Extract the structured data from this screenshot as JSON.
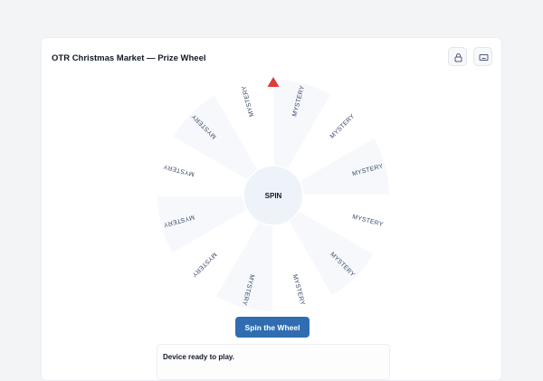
{
  "header": {
    "title": "OTR Christmas Market — Prize Wheel",
    "lock_icon": "lock-icon",
    "screen_icon": "screen-icon"
  },
  "wheel": {
    "hub_label": "SPIN",
    "pointer_icon": "triangle-pointer-icon",
    "segments": [
      "MYSTERY",
      "MYSTERY",
      "MYSTERY",
      "MYSTERY",
      "MYSTERY",
      "MYSTERY",
      "MYSTERY",
      "MYSTERY",
      "MYSTERY",
      "MYSTERY",
      "MYSTERY",
      "MYSTERY"
    ],
    "colors": {
      "segment_a": "#f6f8fc",
      "segment_b": "#ffffff",
      "divider": "#eef1f6",
      "hub": "#eef3fa",
      "pointer": "#e03a3a",
      "label": "#3b4b6b"
    }
  },
  "controls": {
    "spin_button_label": "Spin the Wheel",
    "accent": "#2f6db0"
  },
  "status": {
    "text": "Device ready to play."
  }
}
